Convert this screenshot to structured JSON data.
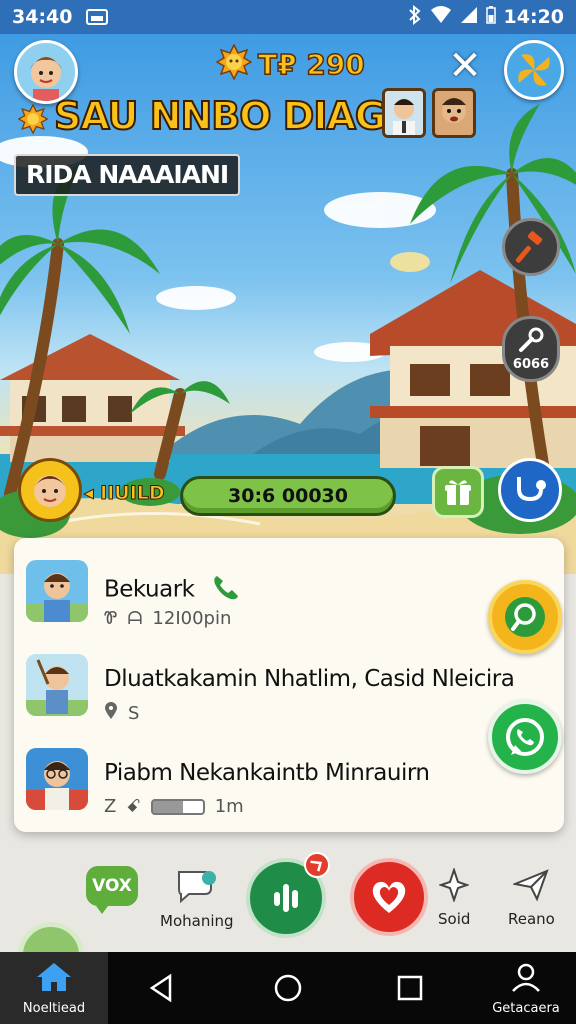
{
  "status_bar": {
    "time_left": "34:40",
    "time_right": "14:20"
  },
  "hud": {
    "coins": "T₽ 290",
    "title": "SAU NNBO DIAGI",
    "location": "RIDA NAAAIANI",
    "tool_label": "6066",
    "level_tag": "◂ IIUILD",
    "progress_text": "30:6 00030"
  },
  "list": {
    "items": [
      {
        "title": "Bekuark",
        "meta": [
          "Ꮘ",
          "ᗩ",
          "12I00pin"
        ]
      },
      {
        "title": "Dluatkakamin Nhatlim, Casid Nleicira",
        "meta": [
          "S"
        ]
      },
      {
        "title": "Piabm Nekankaintb Minrauirn",
        "meta": [
          "Z",
          "ꗃ",
          "1m"
        ]
      }
    ]
  },
  "actions": {
    "vox": "VOX",
    "chat_label": "Mohaning",
    "ai_label": "Soid",
    "send_label": "Reano"
  },
  "nav": {
    "home_label": "Noeltiead",
    "profile_label": "Getacaera"
  },
  "colors": {
    "status_bar": "#2f6fb7",
    "gold": "#f7c21e",
    "green": "#1f8d48",
    "red": "#dd2a22",
    "whatsapp": "#24b24b"
  }
}
